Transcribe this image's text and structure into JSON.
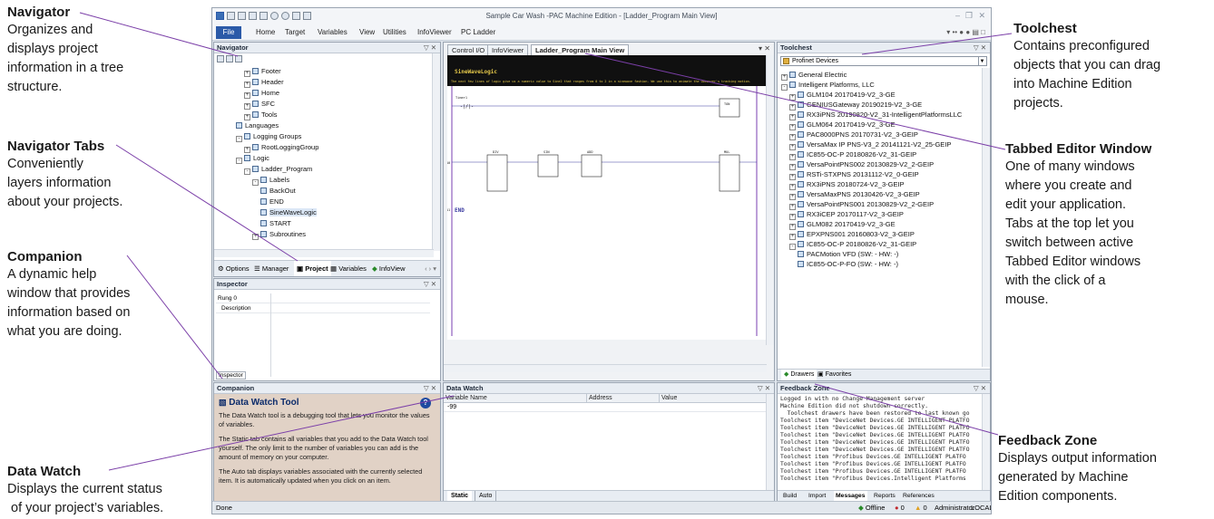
{
  "callouts": {
    "navigator": {
      "title": "Navigator",
      "desc": [
        "Organizes and",
        "displays project",
        "information in a tree",
        "structure."
      ]
    },
    "navigator_tabs": {
      "title": "Navigator Tabs",
      "desc": [
        "Conveniently",
        "layers information",
        "about your projects."
      ]
    },
    "companion": {
      "title": "Companion",
      "desc": [
        "A dynamic help",
        "window that provides",
        "information based on",
        "what you are doing."
      ]
    },
    "data_watch": {
      "title": "Data Watch",
      "desc": [
        "Displays the current status",
        "of your project’s variables."
      ]
    },
    "toolchest": {
      "title": "Toolchest",
      "desc": [
        "Contains preconfigured",
        "objects that you can drag",
        "into Machine Edition",
        "projects."
      ]
    },
    "tabbed_editor": {
      "title": "Tabbed Editor Window",
      "desc": [
        "One of many windows",
        "where you create and",
        "edit your application.",
        "Tabs at the top let you",
        "switch between active",
        "Tabbed Editor windows",
        "with the click of a",
        "mouse."
      ]
    },
    "feedback_zone": {
      "title": "Feedback Zone",
      "desc": [
        "Displays output information",
        "generated by Machine",
        "Edition components."
      ]
    }
  },
  "window": {
    "title": "Sample Car Wash -PAC Machine Edition - [Ladder_Program Main View]",
    "menu": [
      "File",
      "Home",
      "Target",
      "Variables",
      "View",
      "Utilities",
      "InfoViewer",
      "PC Ladder"
    ]
  },
  "navigator": {
    "title": "Navigator",
    "items": [
      {
        "label": "Footer",
        "indent": 3,
        "exp": "+"
      },
      {
        "label": "Header",
        "indent": 3,
        "exp": "+"
      },
      {
        "label": "Home",
        "indent": 3,
        "exp": "+"
      },
      {
        "label": "SFC",
        "indent": 3,
        "exp": "+"
      },
      {
        "label": "Tools",
        "indent": 3,
        "exp": "+"
      },
      {
        "label": "Languages",
        "indent": 2,
        "exp": ""
      },
      {
        "label": "Logging Groups",
        "indent": 2,
        "exp": "-"
      },
      {
        "label": "RootLoggingGroup",
        "indent": 3,
        "exp": "+"
      },
      {
        "label": "Logic",
        "indent": 2,
        "exp": "-"
      },
      {
        "label": "Ladder_Program",
        "indent": 3,
        "exp": "-"
      },
      {
        "label": "Labels",
        "indent": 4,
        "exp": "-"
      },
      {
        "label": "BackOut",
        "indent": 5,
        "exp": ""
      },
      {
        "label": "END",
        "indent": 5,
        "exp": ""
      },
      {
        "label": "SineWaveLogic",
        "indent": 5,
        "exp": "",
        "selected": true
      },
      {
        "label": "START",
        "indent": 5,
        "exp": ""
      },
      {
        "label": "Subroutines",
        "indent": 4,
        "exp": "+"
      }
    ],
    "tabs": [
      "Options",
      "Manager",
      "Project",
      "Variables",
      "InfoView"
    ]
  },
  "inspector": {
    "title": "Inspector",
    "rows": [
      {
        "key": "Rung 0",
        "value": ""
      },
      {
        "key": "Description",
        "value": ""
      }
    ],
    "tab": "Inspector"
  },
  "editor": {
    "tabs": [
      "Control I/O",
      "InfoViewer",
      "Ladder_Program Main View"
    ],
    "active_tab": "Ladder_Program Main View",
    "rung_label": "SineWaveLogic",
    "rung_comment": "The next few lines of logic give us a numeric value to Sine2 that ranges from 0 to 2 in a sinewave fashion. We use this to animate the Observer's tracking motion.",
    "end_label": "END",
    "rung_numbers": [
      "10",
      "11"
    ],
    "timer_name": "Timer1",
    "blocks": [
      "DIV",
      "SIN",
      "ADD",
      "MUL"
    ]
  },
  "toolchest": {
    "title": "Toolchest",
    "dropdown": "Profinet Devices",
    "items": [
      {
        "label": "General Electric",
        "indent": 0,
        "exp": "+"
      },
      {
        "label": "Intelligent Platforms, LLC",
        "indent": 0,
        "exp": "-"
      },
      {
        "label": "GLM104 20170419-V2_3-GE",
        "indent": 1,
        "exp": "+"
      },
      {
        "label": "GENIUSGateway 20190219-V2_3-GE",
        "indent": 1,
        "exp": "+"
      },
      {
        "label": "RX3iPNS 20190820-V2_31-IntelligentPlatformsLLC",
        "indent": 1,
        "exp": "+"
      },
      {
        "label": "GLM064 20170419-V2_3-GE",
        "indent": 1,
        "exp": "+"
      },
      {
        "label": "PAC8000PNS 20170731-V2_3-GEIP",
        "indent": 1,
        "exp": "+"
      },
      {
        "label": "VersaMax IP PNS-V3_2 20141121-V2_25-GEIP",
        "indent": 1,
        "exp": "+"
      },
      {
        "label": "IC855-OC-P 20180826-V2_31-GEIP",
        "indent": 1,
        "exp": "+"
      },
      {
        "label": "VersaPointPNS002 20130829-V2_2-GEIP",
        "indent": 1,
        "exp": "+"
      },
      {
        "label": "RSTi-STXPNS 20131112-V2_0-GEIP",
        "indent": 1,
        "exp": "+"
      },
      {
        "label": "RX3iPNS 20180724-V2_3-GEIP",
        "indent": 1,
        "exp": "+"
      },
      {
        "label": "VersaMaxPNS 20130426-V2_3-GEIP",
        "indent": 1,
        "exp": "+"
      },
      {
        "label": "VersaPointPNS001 20130829-V2_2-GEIP",
        "indent": 1,
        "exp": "+"
      },
      {
        "label": "RX3iCEP 20170117-V2_3-GEIP",
        "indent": 1,
        "exp": "+"
      },
      {
        "label": "GLM082 20170419-V2_3-GE",
        "indent": 1,
        "exp": "+"
      },
      {
        "label": "EPXPNS001 20160803-V2_3-GEIP",
        "indent": 1,
        "exp": "+"
      },
      {
        "label": "IC855-OC-P 20180826-V2_31-GEIP",
        "indent": 1,
        "exp": "-"
      },
      {
        "label": "PACMotion VFD (SW: - HW: -)",
        "indent": 2,
        "exp": ""
      },
      {
        "label": "IC855-OC-P-FO (SW: - HW: -)",
        "indent": 2,
        "exp": ""
      }
    ],
    "tabs": [
      "Drawers",
      "Favorites"
    ]
  },
  "companion": {
    "title": "Companion",
    "heading": "Data Watch Tool",
    "paragraphs": [
      "The Data Watch tool is a debugging tool that lets you monitor the values of variables.",
      "The Static tab contains all variables that you add to the Data Watch tool yourself. The only limit to the number of variables you can add is the amount of memory on your computer.",
      "The Auto tab displays variables associated with the currently selected item. It is automatically updated when you click on an item."
    ]
  },
  "data_watch": {
    "title": "Data Watch",
    "columns": [
      "Variable Name",
      "Address",
      "Value"
    ],
    "rows": [
      [
        "-99",
        "",
        ""
      ]
    ],
    "tabs": [
      "Static",
      "Auto"
    ]
  },
  "feedback": {
    "title": "Feedback Zone",
    "lines": [
      "Logged in with no Change Management server",
      "Machine Edition did not shutdown correctly.",
      "  Toolchest drawers have been restored to last known go",
      "Toolchest item \"DeviceNet Devices.GE INTELLIGENT PLATFO",
      "Toolchest item \"DeviceNet Devices.GE INTELLIGENT PLATFO",
      "Toolchest item \"DeviceNet Devices.GE INTELLIGENT PLATFO",
      "Toolchest item \"DeviceNet Devices.GE INTELLIGENT PLATFO",
      "Toolchest item \"DeviceNet Devices.GE INTELLIGENT PLATFO",
      "Toolchest item \"Profibus Devices.GE INTELLIGENT PLATFO",
      "Toolchest item \"Profibus Devices.GE INTELLIGENT PLATFO",
      "Toolchest item \"Profibus Devices.GE INTELLIGENT PLATFO",
      "Toolchest item \"Profibus Devices.Intelligent Platforms"
    ],
    "tabs": [
      "Build",
      "Import",
      "Messages",
      "Reports",
      "References"
    ]
  },
  "statusbar": {
    "left": "Done",
    "offline": "Offline",
    "errors": "0",
    "warnings": "0",
    "user": "Administrator",
    "mode": "LOCAL"
  },
  "colors": {
    "leader": "#7b3fa8",
    "accent": "#2b5aa8",
    "companion_bg": "#e1d2c6"
  }
}
